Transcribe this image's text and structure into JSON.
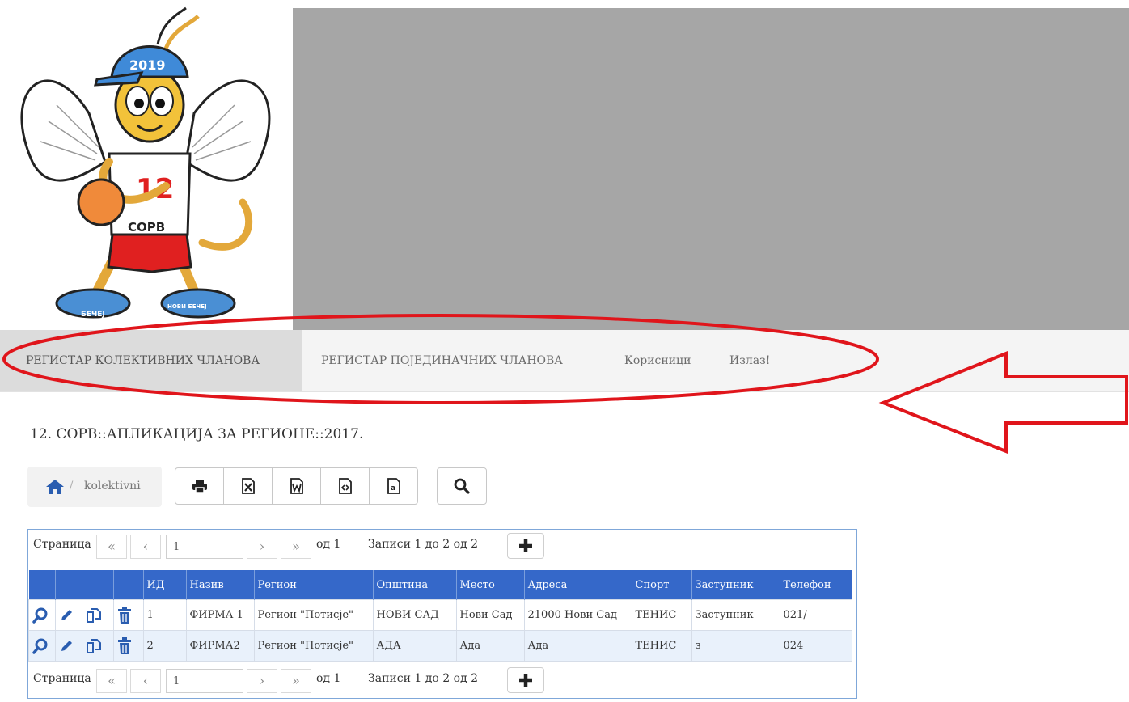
{
  "logo": {
    "year": "2019",
    "number": "12",
    "shirt": "СОРВ",
    "shoe_left": "БЕЧЕЈ",
    "shoe_right": "НОВИ БЕЧЕЈ"
  },
  "nav": {
    "items": [
      {
        "label": "РЕГИСТАР КОЛЕКТИВНИХ ЧЛАНОВА",
        "active": true
      },
      {
        "label": "РЕГИСТАР ПОЈЕДИНАЧНИХ ЧЛАНОВА",
        "active": false
      },
      {
        "label": "Корисници",
        "active": false
      },
      {
        "label": "Излаз!",
        "active": false
      }
    ]
  },
  "page": {
    "title": "12. СОРВ::АПЛИКАЦИЈА ЗА РЕГИОНЕ::2017."
  },
  "breadcrumb": {
    "icon": "home-icon",
    "current": "kolektivni"
  },
  "toolbar": {
    "icons": [
      "print-icon",
      "excel-icon",
      "word-icon",
      "xml-icon",
      "text-icon",
      "search-icon"
    ]
  },
  "pager": {
    "label": "Страница",
    "page_value": "1",
    "of_label": "од 1",
    "records": "Записи 1 до 2 од 2"
  },
  "table": {
    "columns": [
      "ИД",
      "Назив",
      "Регион",
      "Општина",
      "Место",
      "Адреса",
      "Спорт",
      "Заступник",
      "Телефон"
    ],
    "rows": [
      [
        "1",
        "ФИРМА 1",
        "Регион \"Потисје\"",
        "НОВИ САД",
        "Нови Сад",
        "21000 Нови Сад",
        "ТЕНИС",
        "Заступник",
        "021/"
      ],
      [
        "2",
        "ФИРМА2",
        "Регион \"Потисје\"",
        "АДА",
        "Ада",
        "Ада",
        "ТЕНИС",
        "з",
        "024"
      ]
    ],
    "row_actions": [
      "view-icon",
      "edit-icon",
      "copy-icon",
      "delete-icon"
    ]
  },
  "colors": {
    "header_blue": "#3568c9",
    "action_blue": "#2a5db0",
    "annotation_red": "#e0151b",
    "banner_gray": "#a6a6a6"
  }
}
